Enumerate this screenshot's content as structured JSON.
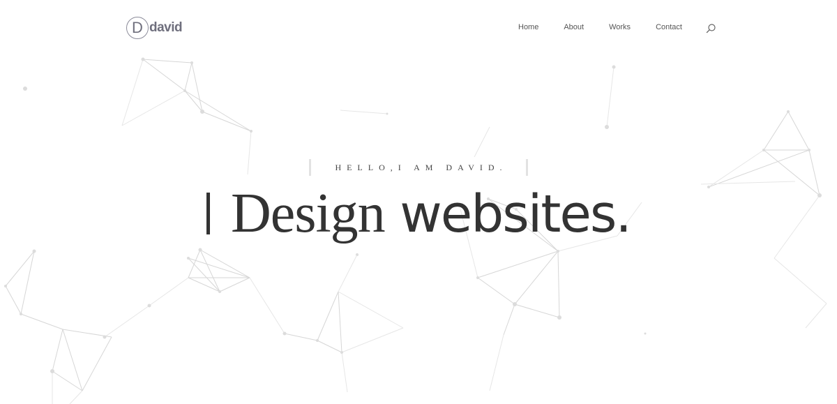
{
  "brand": {
    "mark": "D",
    "name": "david"
  },
  "nav": {
    "items": [
      {
        "label": "Home"
      },
      {
        "label": "About"
      },
      {
        "label": "Works"
      },
      {
        "label": "Contact"
      }
    ],
    "search_icon": "search-icon"
  },
  "hero": {
    "tagline": "HELLO,I AM DAVID.",
    "headline_serif": "Design",
    "headline_sans": "websites.",
    "headline_prefix": "I"
  },
  "colors": {
    "text": "#333333",
    "logo": "#6f6f7d",
    "network": "#d6d6d6",
    "background": "#ffffff"
  }
}
